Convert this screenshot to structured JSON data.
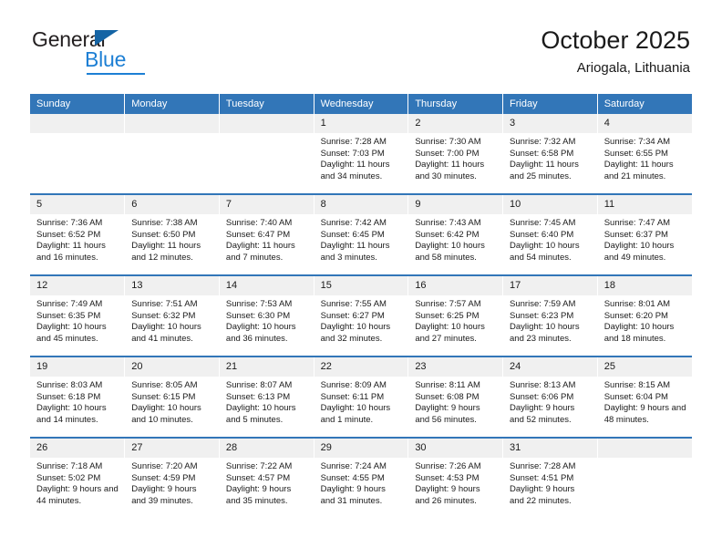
{
  "brand": {
    "name_top": "General",
    "name_bottom": "Blue",
    "triangle_icon": "triangle-icon",
    "accent_color": "#1d7fd4"
  },
  "header": {
    "title": "October 2025",
    "subtitle": "Ariogala, Lithuania"
  },
  "theme": {
    "header_blue": "#3276b8",
    "daynum_gray": "#f0f0f0",
    "text": "#1a1a1a"
  },
  "weekdays": [
    "Sunday",
    "Monday",
    "Tuesday",
    "Wednesday",
    "Thursday",
    "Friday",
    "Saturday"
  ],
  "labels": {
    "sunrise_prefix": "Sunrise:",
    "sunset_prefix": "Sunset:",
    "daylight_prefix": "Daylight:"
  },
  "weeks": [
    [
      {
        "day": "",
        "empty": true
      },
      {
        "day": "",
        "empty": true
      },
      {
        "day": "",
        "empty": true
      },
      {
        "day": "1",
        "sunrise": "Sunrise: 7:28 AM",
        "sunset": "Sunset: 7:03 PM",
        "daylight": "Daylight: 11 hours and 34 minutes."
      },
      {
        "day": "2",
        "sunrise": "Sunrise: 7:30 AM",
        "sunset": "Sunset: 7:00 PM",
        "daylight": "Daylight: 11 hours and 30 minutes."
      },
      {
        "day": "3",
        "sunrise": "Sunrise: 7:32 AM",
        "sunset": "Sunset: 6:58 PM",
        "daylight": "Daylight: 11 hours and 25 minutes."
      },
      {
        "day": "4",
        "sunrise": "Sunrise: 7:34 AM",
        "sunset": "Sunset: 6:55 PM",
        "daylight": "Daylight: 11 hours and 21 minutes."
      }
    ],
    [
      {
        "day": "5",
        "sunrise": "Sunrise: 7:36 AM",
        "sunset": "Sunset: 6:52 PM",
        "daylight": "Daylight: 11 hours and 16 minutes."
      },
      {
        "day": "6",
        "sunrise": "Sunrise: 7:38 AM",
        "sunset": "Sunset: 6:50 PM",
        "daylight": "Daylight: 11 hours and 12 minutes."
      },
      {
        "day": "7",
        "sunrise": "Sunrise: 7:40 AM",
        "sunset": "Sunset: 6:47 PM",
        "daylight": "Daylight: 11 hours and 7 minutes."
      },
      {
        "day": "8",
        "sunrise": "Sunrise: 7:42 AM",
        "sunset": "Sunset: 6:45 PM",
        "daylight": "Daylight: 11 hours and 3 minutes."
      },
      {
        "day": "9",
        "sunrise": "Sunrise: 7:43 AM",
        "sunset": "Sunset: 6:42 PM",
        "daylight": "Daylight: 10 hours and 58 minutes."
      },
      {
        "day": "10",
        "sunrise": "Sunrise: 7:45 AM",
        "sunset": "Sunset: 6:40 PM",
        "daylight": "Daylight: 10 hours and 54 minutes."
      },
      {
        "day": "11",
        "sunrise": "Sunrise: 7:47 AM",
        "sunset": "Sunset: 6:37 PM",
        "daylight": "Daylight: 10 hours and 49 minutes."
      }
    ],
    [
      {
        "day": "12",
        "sunrise": "Sunrise: 7:49 AM",
        "sunset": "Sunset: 6:35 PM",
        "daylight": "Daylight: 10 hours and 45 minutes."
      },
      {
        "day": "13",
        "sunrise": "Sunrise: 7:51 AM",
        "sunset": "Sunset: 6:32 PM",
        "daylight": "Daylight: 10 hours and 41 minutes."
      },
      {
        "day": "14",
        "sunrise": "Sunrise: 7:53 AM",
        "sunset": "Sunset: 6:30 PM",
        "daylight": "Daylight: 10 hours and 36 minutes."
      },
      {
        "day": "15",
        "sunrise": "Sunrise: 7:55 AM",
        "sunset": "Sunset: 6:27 PM",
        "daylight": "Daylight: 10 hours and 32 minutes."
      },
      {
        "day": "16",
        "sunrise": "Sunrise: 7:57 AM",
        "sunset": "Sunset: 6:25 PM",
        "daylight": "Daylight: 10 hours and 27 minutes."
      },
      {
        "day": "17",
        "sunrise": "Sunrise: 7:59 AM",
        "sunset": "Sunset: 6:23 PM",
        "daylight": "Daylight: 10 hours and 23 minutes."
      },
      {
        "day": "18",
        "sunrise": "Sunrise: 8:01 AM",
        "sunset": "Sunset: 6:20 PM",
        "daylight": "Daylight: 10 hours and 18 minutes."
      }
    ],
    [
      {
        "day": "19",
        "sunrise": "Sunrise: 8:03 AM",
        "sunset": "Sunset: 6:18 PM",
        "daylight": "Daylight: 10 hours and 14 minutes."
      },
      {
        "day": "20",
        "sunrise": "Sunrise: 8:05 AM",
        "sunset": "Sunset: 6:15 PM",
        "daylight": "Daylight: 10 hours and 10 minutes."
      },
      {
        "day": "21",
        "sunrise": "Sunrise: 8:07 AM",
        "sunset": "Sunset: 6:13 PM",
        "daylight": "Daylight: 10 hours and 5 minutes."
      },
      {
        "day": "22",
        "sunrise": "Sunrise: 8:09 AM",
        "sunset": "Sunset: 6:11 PM",
        "daylight": "Daylight: 10 hours and 1 minute."
      },
      {
        "day": "23",
        "sunrise": "Sunrise: 8:11 AM",
        "sunset": "Sunset: 6:08 PM",
        "daylight": "Daylight: 9 hours and 56 minutes."
      },
      {
        "day": "24",
        "sunrise": "Sunrise: 8:13 AM",
        "sunset": "Sunset: 6:06 PM",
        "daylight": "Daylight: 9 hours and 52 minutes."
      },
      {
        "day": "25",
        "sunrise": "Sunrise: 8:15 AM",
        "sunset": "Sunset: 6:04 PM",
        "daylight": "Daylight: 9 hours and 48 minutes."
      }
    ],
    [
      {
        "day": "26",
        "sunrise": "Sunrise: 7:18 AM",
        "sunset": "Sunset: 5:02 PM",
        "daylight": "Daylight: 9 hours and 44 minutes."
      },
      {
        "day": "27",
        "sunrise": "Sunrise: 7:20 AM",
        "sunset": "Sunset: 4:59 PM",
        "daylight": "Daylight: 9 hours and 39 minutes."
      },
      {
        "day": "28",
        "sunrise": "Sunrise: 7:22 AM",
        "sunset": "Sunset: 4:57 PM",
        "daylight": "Daylight: 9 hours and 35 minutes."
      },
      {
        "day": "29",
        "sunrise": "Sunrise: 7:24 AM",
        "sunset": "Sunset: 4:55 PM",
        "daylight": "Daylight: 9 hours and 31 minutes."
      },
      {
        "day": "30",
        "sunrise": "Sunrise: 7:26 AM",
        "sunset": "Sunset: 4:53 PM",
        "daylight": "Daylight: 9 hours and 26 minutes."
      },
      {
        "day": "31",
        "sunrise": "Sunrise: 7:28 AM",
        "sunset": "Sunset: 4:51 PM",
        "daylight": "Daylight: 9 hours and 22 minutes."
      },
      {
        "day": "",
        "empty": true
      }
    ]
  ]
}
